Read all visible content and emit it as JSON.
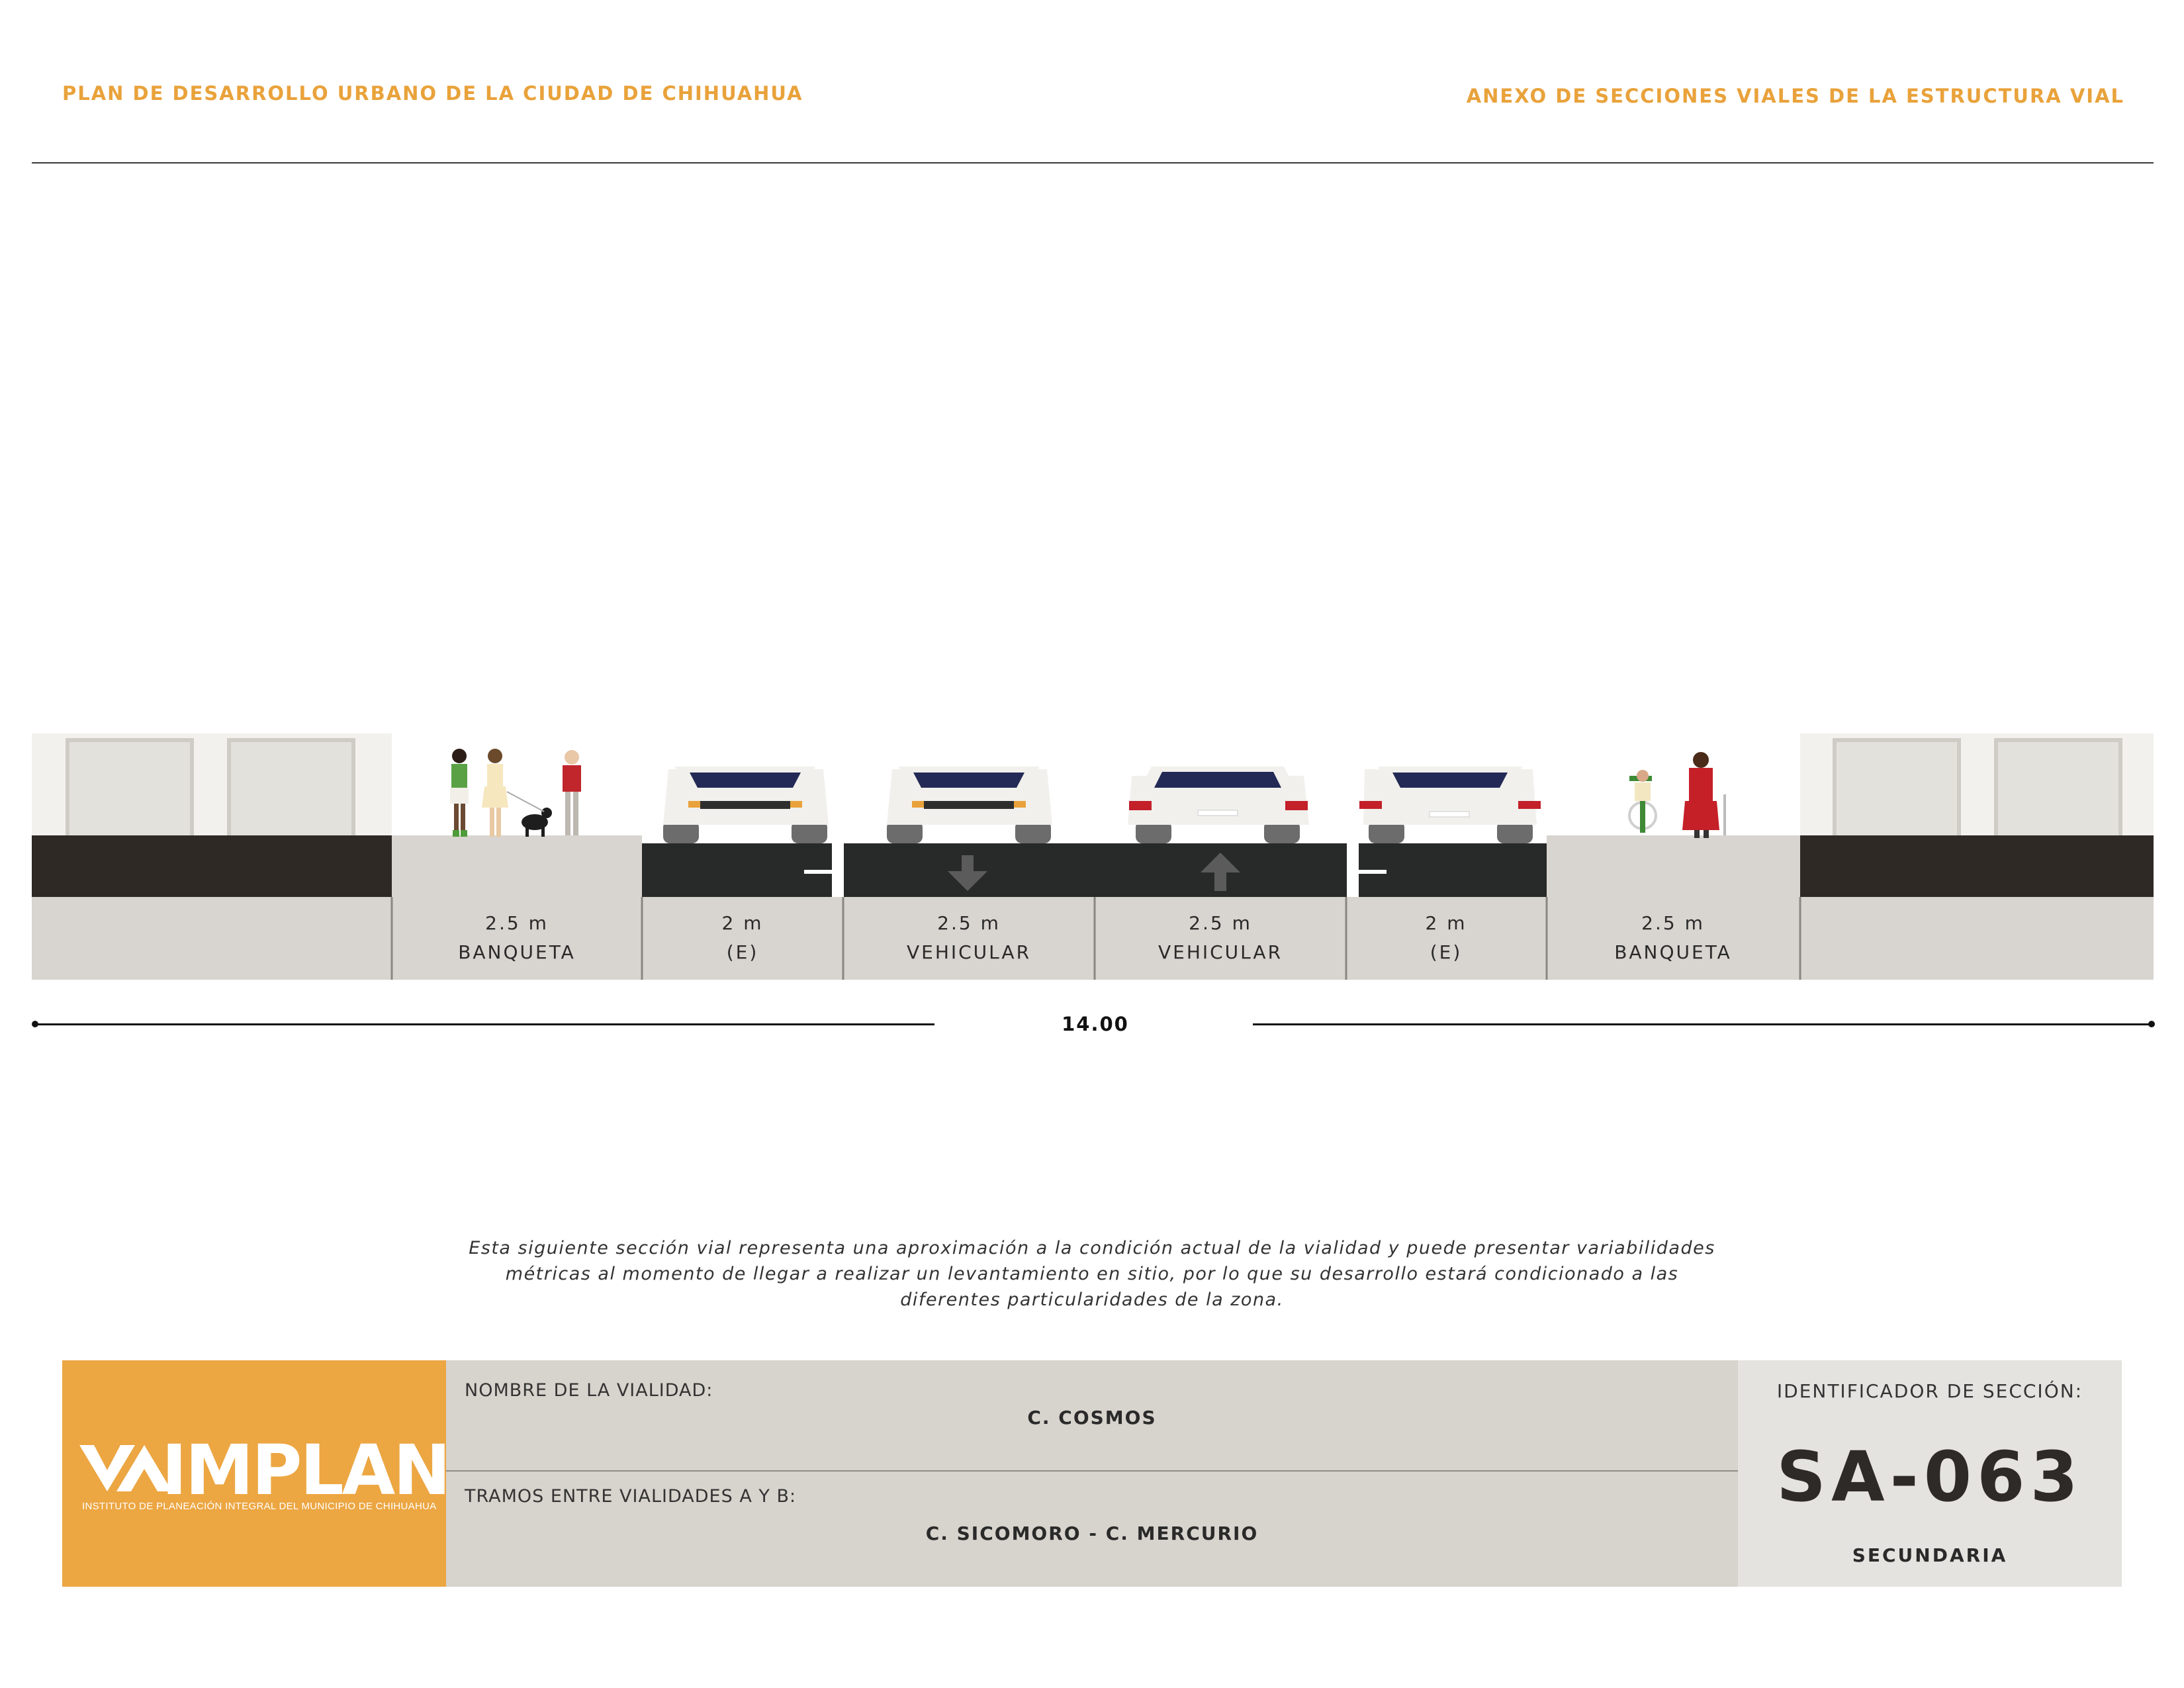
{
  "header": {
    "left": "PLAN DE DESARROLLO URBANO DE LA CIUDAD DE CHIHUAHUA",
    "right": "ANEXO DE SECCIONES VIALES DE LA ESTRUCTURA VIAL"
  },
  "section": {
    "segments": [
      {
        "width": "2.5 m",
        "label": "BANQUETA",
        "type": "sidewalk"
      },
      {
        "width": "2 m",
        "label": "(E)",
        "type": "parking"
      },
      {
        "width": "2.5 m",
        "label": "VEHICULAR",
        "type": "lane",
        "direction": "down"
      },
      {
        "width": "2.5 m",
        "label": "VEHICULAR",
        "type": "lane",
        "direction": "up"
      },
      {
        "width": "2 m",
        "label": "(E)",
        "type": "parking"
      },
      {
        "width": "2.5 m",
        "label": "BANQUETA",
        "type": "sidewalk"
      }
    ],
    "total": "14.00"
  },
  "note": "Esta siguiente sección vial representa una aproximación a la condición actual de la vialidad y puede presentar variabilidades métricas al momento de llegar a realizar un levantamiento en sitio, por lo que su desarrollo estará condicionado a las diferentes particularidades de la zona.",
  "titleblock": {
    "logo_text": "IMPLAN",
    "logo_subtitle": "INSTITUTO DE PLANEACIÓN INTEGRAL DEL MUNICIPIO DE CHIHUAHUA",
    "road_name_label": "NOMBRE DE LA VIALIDAD:",
    "road_name": "C. COSMOS",
    "segment_label": "TRAMOS ENTRE VIALIDADES A Y B:",
    "segment": "C. SICOMORO - C. MERCURIO",
    "id_label": "IDENTIFICADOR DE SECCIÓN:",
    "id": "SA-063",
    "classification": "SECUNDARIA"
  },
  "colors": {
    "accent": "#e9a23b",
    "asphalt": "#282a29",
    "ground": "#d8d4cf",
    "building_base": "#2f2926"
  }
}
